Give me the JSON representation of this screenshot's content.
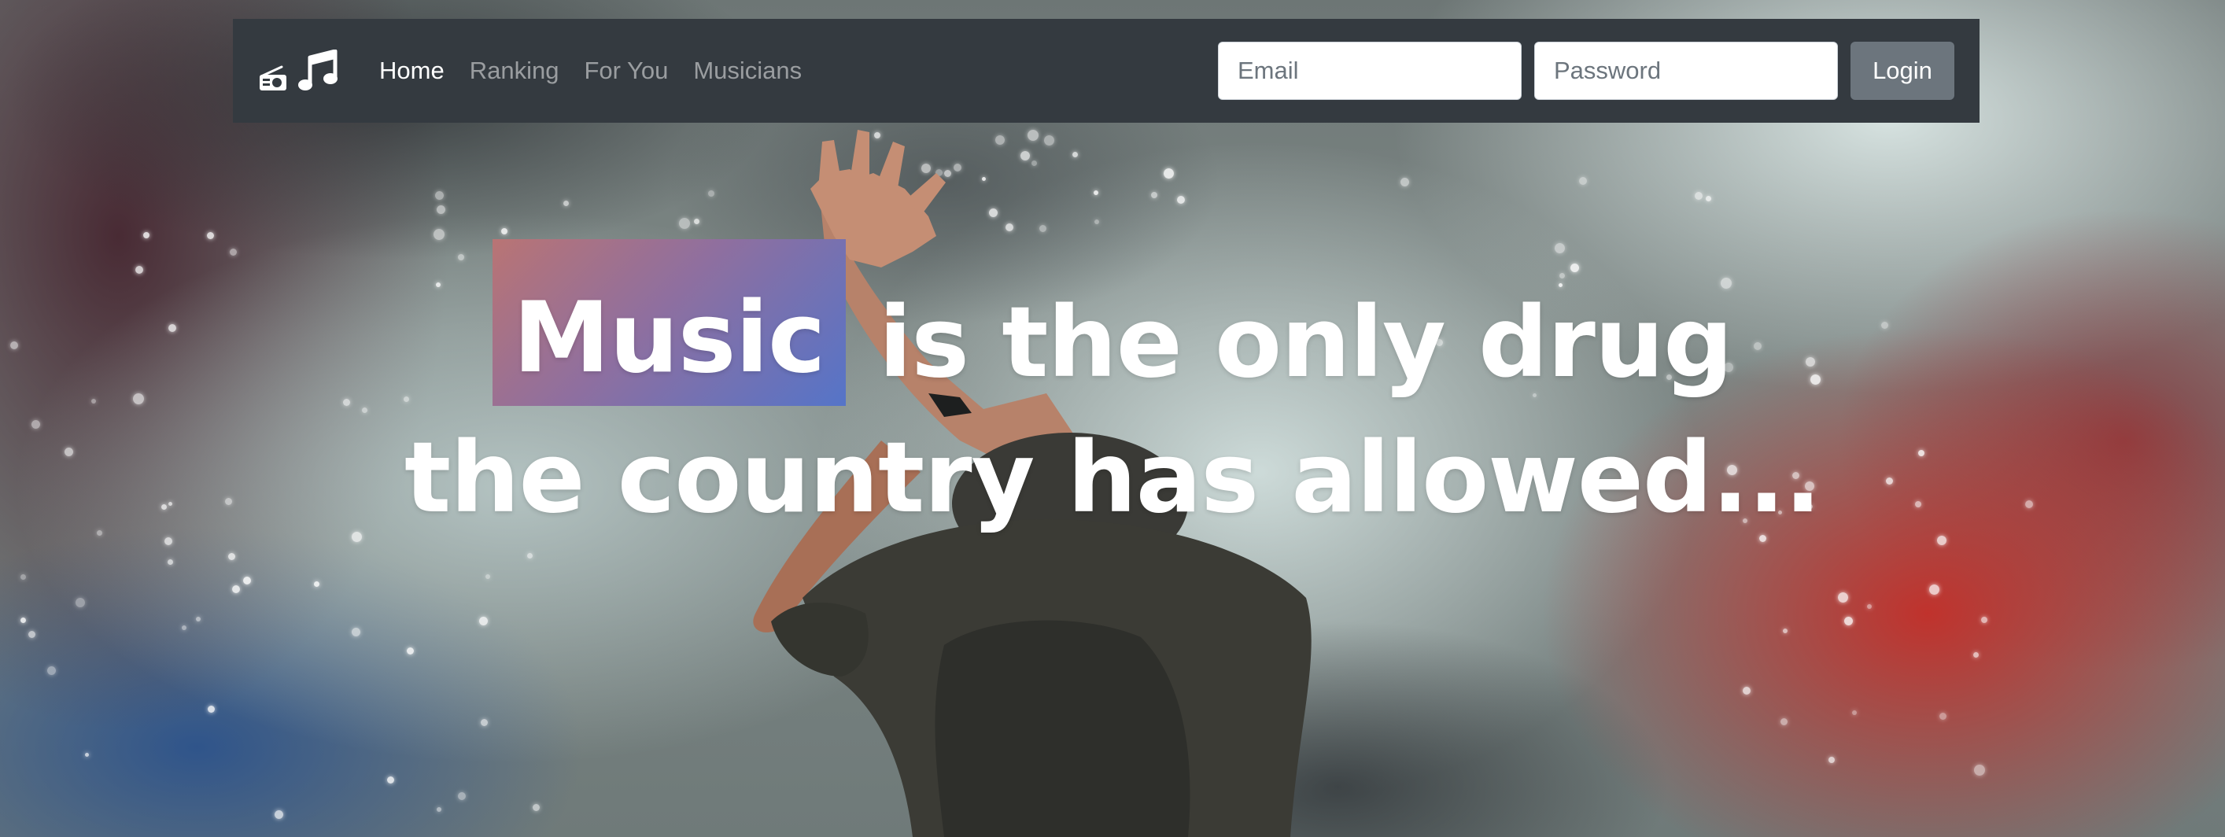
{
  "navbar": {
    "brand_icons": [
      "radio-icon",
      "music-note-icon"
    ],
    "links": [
      {
        "label": "Home",
        "active": true
      },
      {
        "label": "Ranking",
        "active": false
      },
      {
        "label": "For You",
        "active": false
      },
      {
        "label": "Musicians",
        "active": false
      }
    ],
    "login_form": {
      "email_placeholder": "Email",
      "email_value": "",
      "password_placeholder": "Password",
      "password_value": "",
      "submit_label": "Login"
    }
  },
  "hero": {
    "highlight_word": "Music",
    "line1_rest": " is the only drug",
    "line2": "the country has allowed..."
  },
  "colors": {
    "navbar_bg": "#343a40",
    "button_bg": "#6c757d",
    "highlight_gradient_start": "#b97474",
    "highlight_gradient_end": "#5574c8"
  }
}
